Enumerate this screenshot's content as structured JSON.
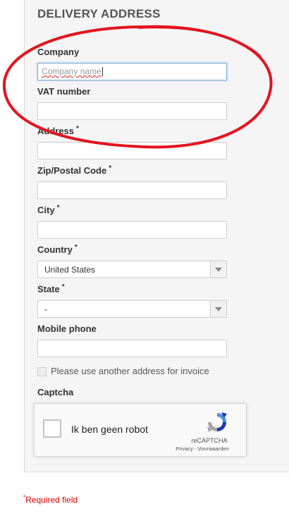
{
  "section_title": "DELIVERY ADDRESS",
  "fields": {
    "company": {
      "label": "Company",
      "placeholder": "Company name"
    },
    "vat": {
      "label": "VAT number"
    },
    "address": {
      "label": "Address",
      "required_mark": "*"
    },
    "zip": {
      "label": "Zip/Postal Code",
      "required_mark": "*"
    },
    "city": {
      "label": "City",
      "required_mark": "*"
    },
    "country": {
      "label": "Country",
      "required_mark": "*",
      "value": "United States"
    },
    "state": {
      "label": "State",
      "required_mark": "*",
      "value": "-"
    },
    "mobile": {
      "label": "Mobile phone"
    }
  },
  "invoice_checkbox_label": "Please use another address for invoice",
  "captcha": {
    "label": "Captcha",
    "checkbox_text": "Ik ben geen robot",
    "brand": "reCAPTCHA",
    "privacy": "Privacy",
    "separator": " - ",
    "terms": "Voorwaarden",
    "logo_icon": "recaptcha-logo-icon"
  },
  "footer": {
    "required_mark": "*",
    "required_text": "Required field"
  },
  "colors": {
    "annotation": "#e3141e",
    "required": "#dd0000",
    "focus_border": "#77aedd"
  }
}
